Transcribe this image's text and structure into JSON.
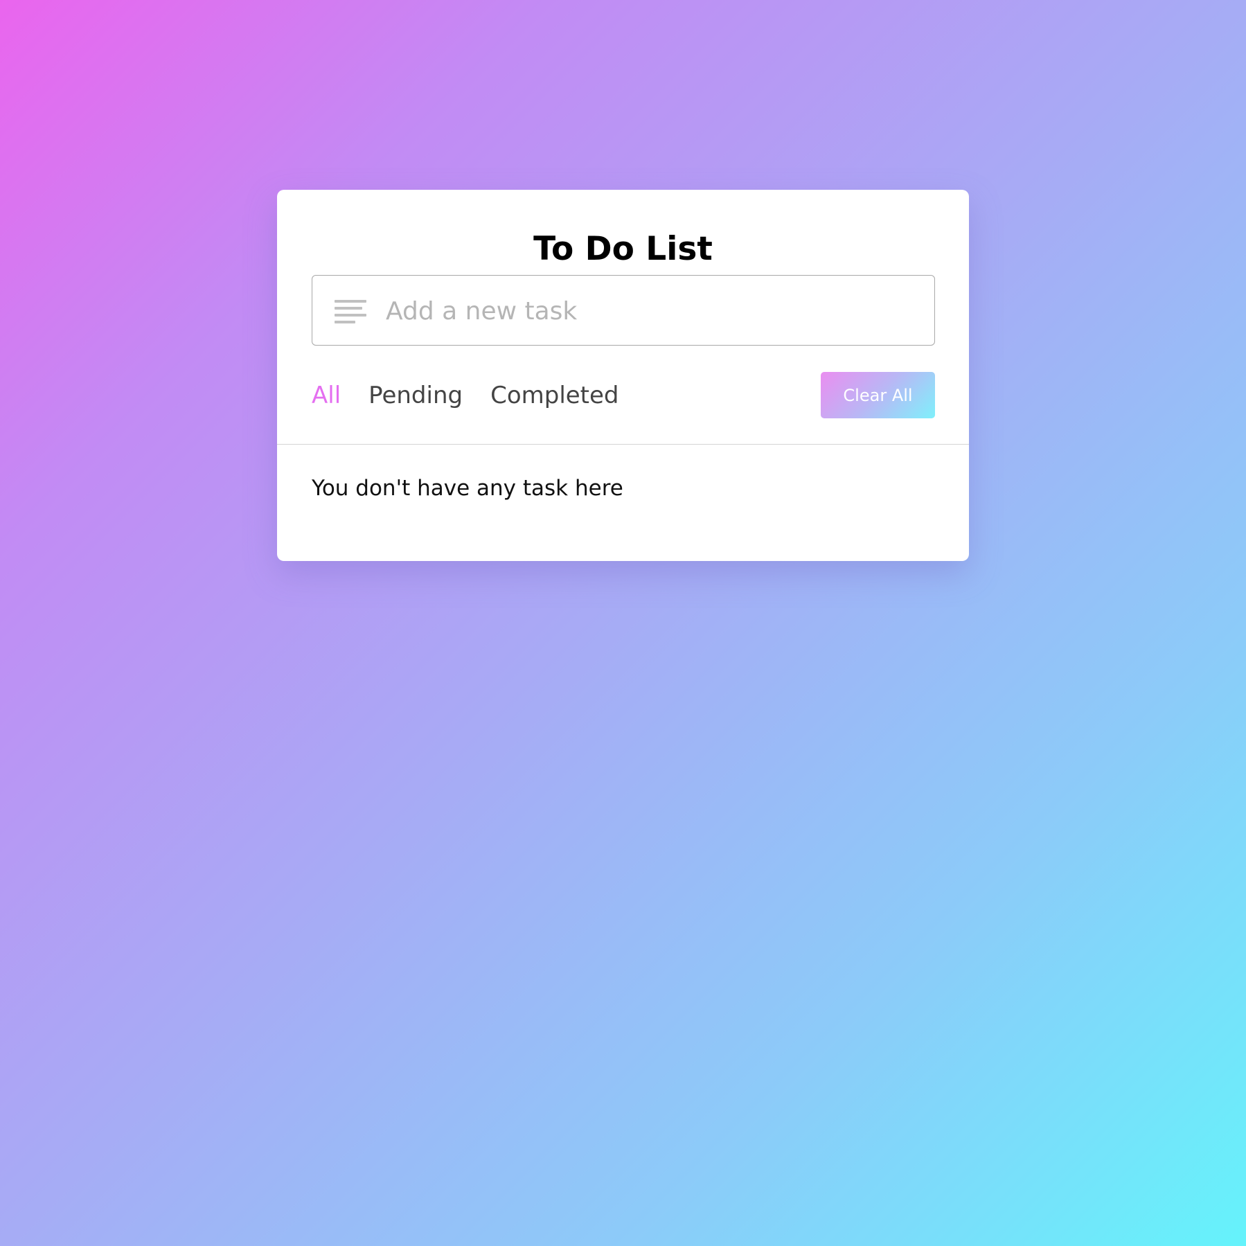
{
  "app": {
    "title": "To Do List"
  },
  "task_input": {
    "placeholder": "Add a new task",
    "value": "",
    "icon": "list-lines-icon"
  },
  "filters": [
    {
      "label": "All",
      "active": true
    },
    {
      "label": "Pending",
      "active": false
    },
    {
      "label": "Completed",
      "active": false
    }
  ],
  "clear_button": {
    "label": "Clear All"
  },
  "task_list": {
    "empty_message": "You don't have any task here"
  },
  "colors": {
    "active_filter": "#e46ff0",
    "gradient_start": "#ea65ee",
    "gradient_end": "#65f3fb"
  }
}
